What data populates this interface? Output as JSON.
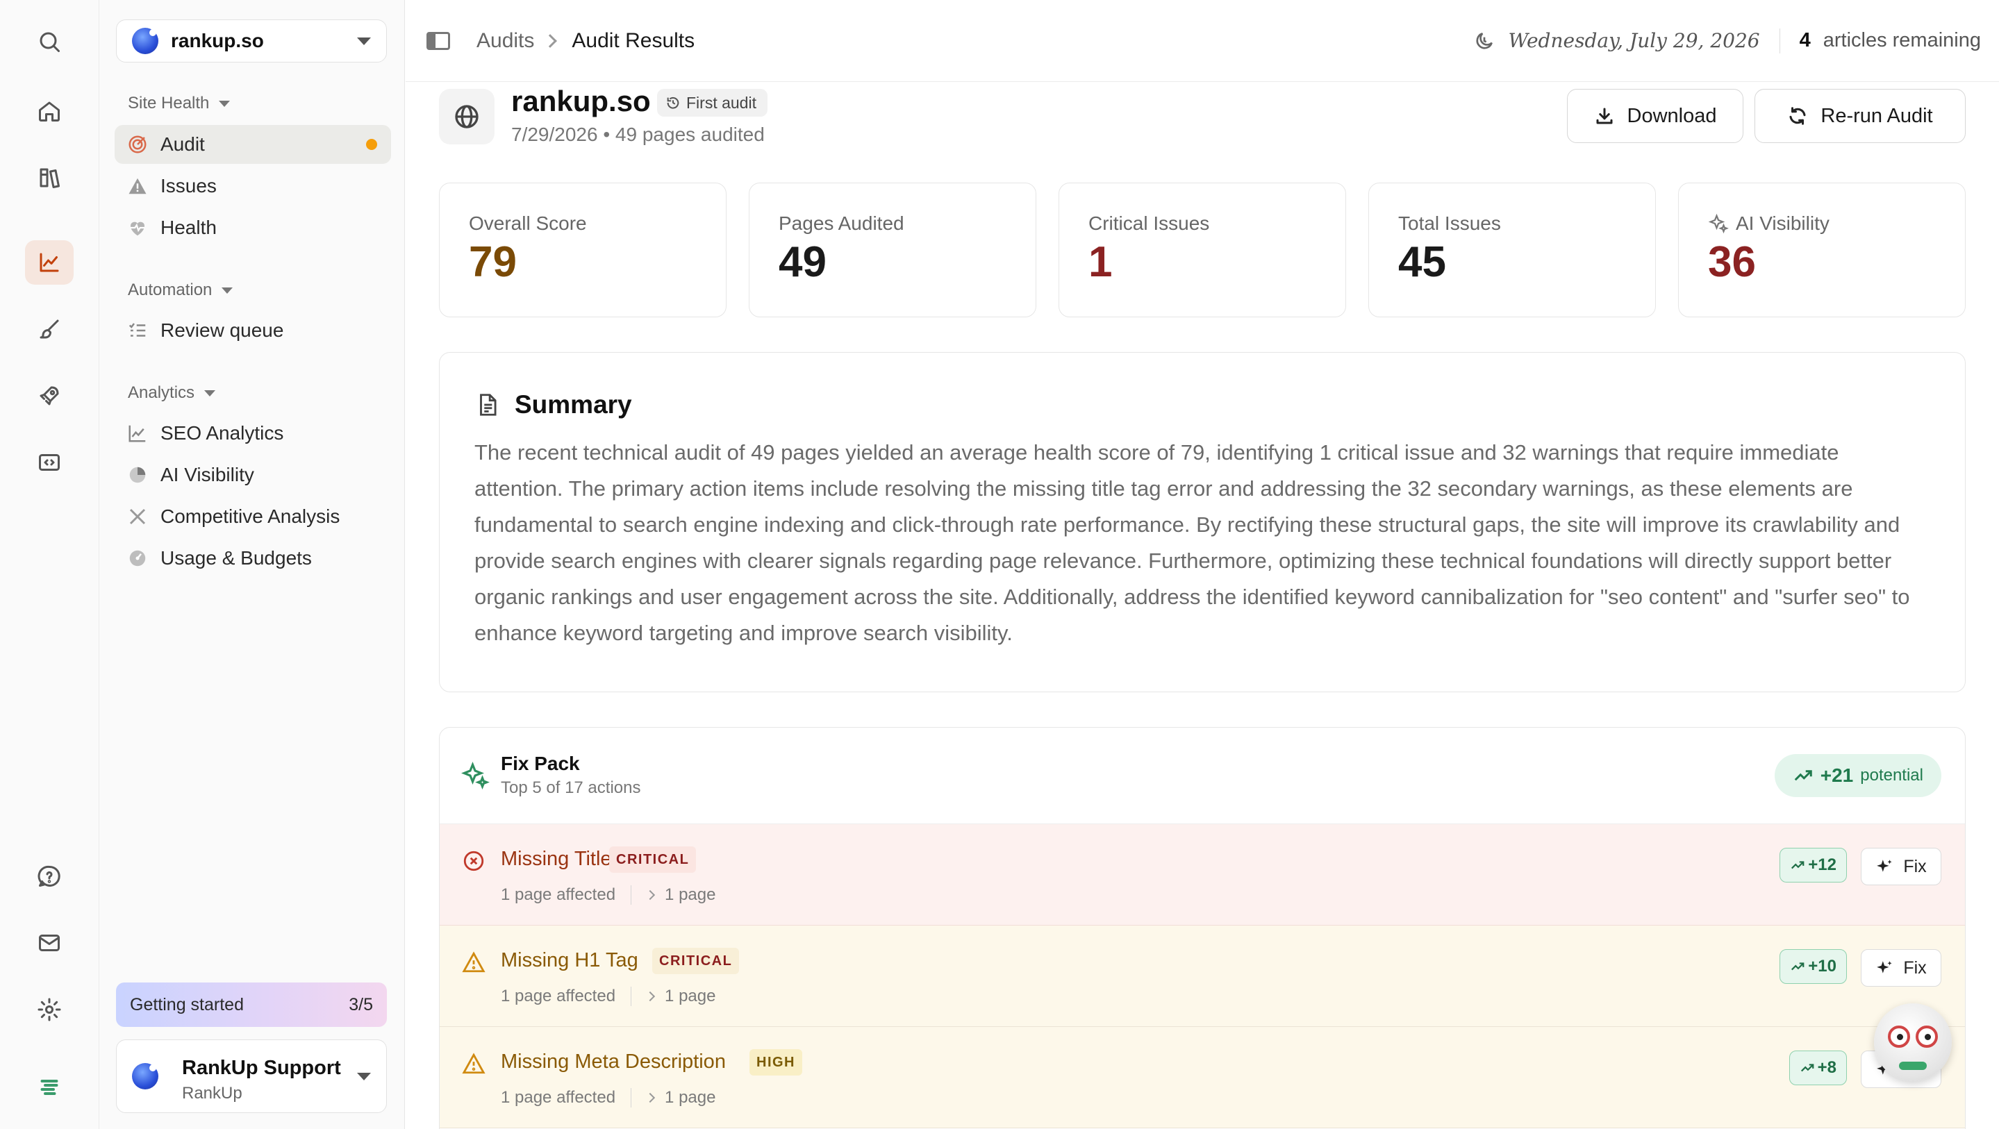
{
  "rail": {
    "top_icons": [
      "search-icon",
      "home-icon",
      "library-icon",
      "analytics-icon",
      "brush-icon",
      "rocket-icon",
      "embed-icon"
    ],
    "active": "analytics-icon",
    "bottom_icons": [
      "help-icon",
      "mail-icon",
      "settings-icon",
      "brand-logo-icon"
    ]
  },
  "sidebar": {
    "site": "rankup.so",
    "sections": {
      "site_health": "Site Health",
      "automation": "Automation",
      "analytics": "Analytics"
    },
    "items": {
      "audit": "Audit",
      "issues": "Issues",
      "health": "Health",
      "review_queue": "Review queue",
      "seo_analytics": "SEO Analytics",
      "ai_visibility": "AI Visibility",
      "competitive": "Competitive Analysis",
      "usage": "Usage & Budgets"
    },
    "getting_started": {
      "label": "Getting started",
      "progress": "3/5"
    },
    "support": {
      "name": "RankUp Support",
      "org": "RankUp"
    }
  },
  "topbar": {
    "crumbs": [
      "Audits",
      "Audit Results"
    ],
    "date": "Wednesday, July 29, 2026",
    "articles_count": "4",
    "articles_label": "articles remaining"
  },
  "header": {
    "title": "rankup.so",
    "badge": "First audit",
    "subtitle": "7/29/2026 • 49 pages audited",
    "download": "Download",
    "rerun": "Re-run Audit"
  },
  "stats": [
    {
      "label": "Overall Score",
      "value": "79",
      "color": "#7a4a06"
    },
    {
      "label": "Pages Audited",
      "value": "49",
      "color": "#1a1a1a"
    },
    {
      "label": "Critical Issues",
      "value": "1",
      "color": "#8b2222"
    },
    {
      "label": "Total Issues",
      "value": "45",
      "color": "#1a1a1a"
    },
    {
      "label": "AI Visibility",
      "value": "36",
      "color": "#8b2222"
    }
  ],
  "summary": {
    "title": "Summary",
    "text": "The recent technical audit of 49 pages yielded an average health score of 79, identifying 1 critical issue and 32 warnings that require immediate attention. The primary action items include resolving the missing title tag error and addressing the 32 secondary warnings, as these elements are fundamental to search engine indexing and click-through rate performance. By rectifying these structural gaps, the site will improve its crawlability and provide search engines with clearer signals regarding page relevance. Furthermore, optimizing these technical foundations will directly support better organic rankings and user engagement across the site. Additionally, address the identified keyword cannibalization for \"seo content\" and \"surfer seo\" to enhance keyword targeting and improve search visibility."
  },
  "fixpack": {
    "title": "Fix Pack",
    "subtitle": "Top 5 of 17 actions",
    "potential_value": "+21",
    "potential_label": "potential",
    "fix_label": "Fix",
    "rows": [
      {
        "title": "Missing Title Tag",
        "severity": "CRITICAL",
        "affected": "1 page affected",
        "pages": "1 page",
        "points": "+12"
      },
      {
        "title": "Missing H1 Tag",
        "severity": "CRITICAL",
        "affected": "1 page affected",
        "pages": "1 page",
        "points": "+10"
      },
      {
        "title": "Missing Meta Description",
        "severity": "HIGH",
        "affected": "1 page affected",
        "pages": "1 page",
        "points": "+8"
      }
    ]
  },
  "colors": {
    "accent": "#c2410c",
    "critical_bg": "#fdf1ef",
    "warning_bg": "#fdf8ea",
    "positive": "#1f7a4d"
  }
}
